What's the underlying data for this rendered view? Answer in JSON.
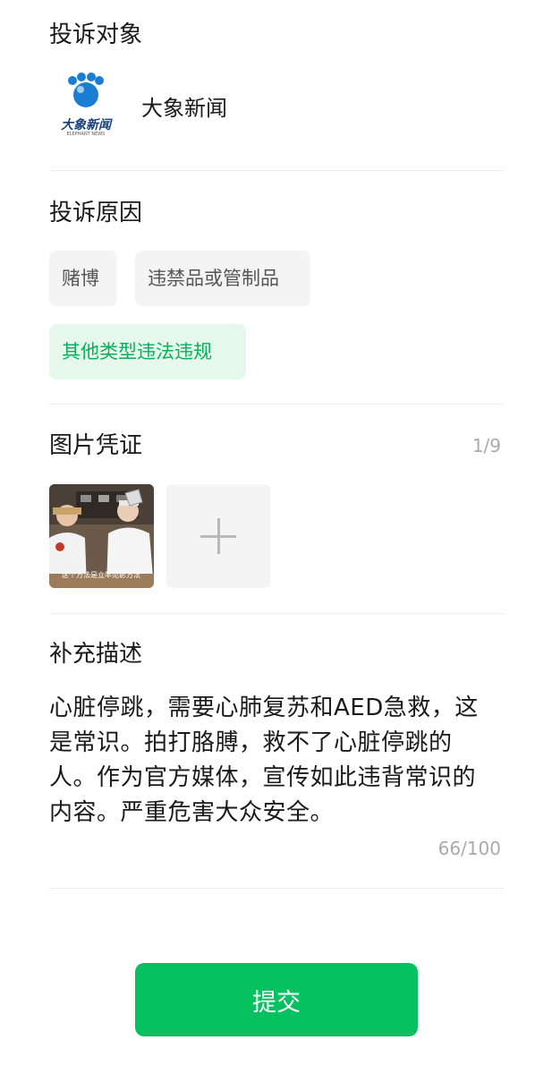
{
  "target": {
    "title": "投诉对象",
    "name": "大象新闻",
    "logo_text": "大象新闻",
    "logo_subtext": "ELEPHANT NEWS"
  },
  "reason": {
    "title": "投诉原因",
    "options": [
      "赌博",
      "违禁品或管制品",
      "其他类型违法违规"
    ],
    "selected": "其他类型违法违规"
  },
  "images": {
    "title": "图片凭证",
    "count": "1/9",
    "thumb_caption": "这个方法是立竿见影方法"
  },
  "description": {
    "title": "补充描述",
    "text": "心脏停跳，需要心肺复苏和AED急救，这是常识。拍打胳膊，救不了心脏停跳的人。作为官方媒体，宣传如此违背常识的内容。严重危害大众安全。",
    "count": "66/100"
  },
  "submit_label": "提交",
  "colors": {
    "accent": "#07c160",
    "selected_chip_bg": "#e6f7ec",
    "selected_chip_text": "#07b05b",
    "logo_blue": "#1a7fd4"
  }
}
